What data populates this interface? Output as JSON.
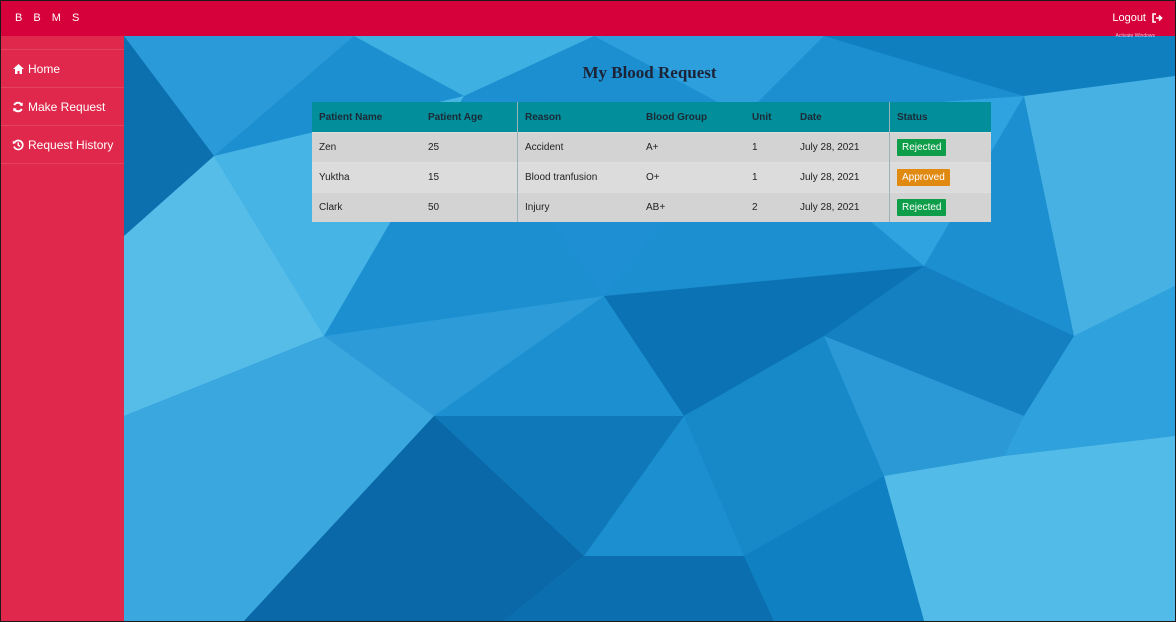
{
  "header": {
    "brand": "B B M S",
    "logout_label": "Logout",
    "logout_icon": "sign-out-icon",
    "tiny_text": "Activate Windows"
  },
  "sidebar": {
    "items": [
      {
        "label": "Home",
        "icon": "home-icon"
      },
      {
        "label": "Make Request",
        "icon": "refresh-icon"
      },
      {
        "label": "Request History",
        "icon": "history-icon"
      }
    ]
  },
  "main": {
    "title": "My Blood Request",
    "table": {
      "headers": [
        "Patient Name",
        "Patient Age",
        "Reason",
        "Blood Group",
        "Unit",
        "Date",
        "Status"
      ],
      "rows": [
        {
          "name": "Zen",
          "age": "25",
          "reason": "Accident",
          "group": "A+",
          "unit": "1",
          "date": "July 28, 2021",
          "status": "Rejected"
        },
        {
          "name": "Yuktha",
          "age": "15",
          "reason": "Blood tranfusion",
          "group": "O+",
          "unit": "1",
          "date": "July 28, 2021",
          "status": "Approved"
        },
        {
          "name": "Clark",
          "age": "50",
          "reason": "Injury",
          "group": "AB+",
          "unit": "2",
          "date": "July 28, 2021",
          "status": "Rejected"
        }
      ]
    }
  },
  "colors": {
    "topbar": "#d6003a",
    "sidebar": "#e0284c",
    "table_header": "#028e9a",
    "rejected": "#0e9e4a",
    "approved": "#e08a12"
  }
}
